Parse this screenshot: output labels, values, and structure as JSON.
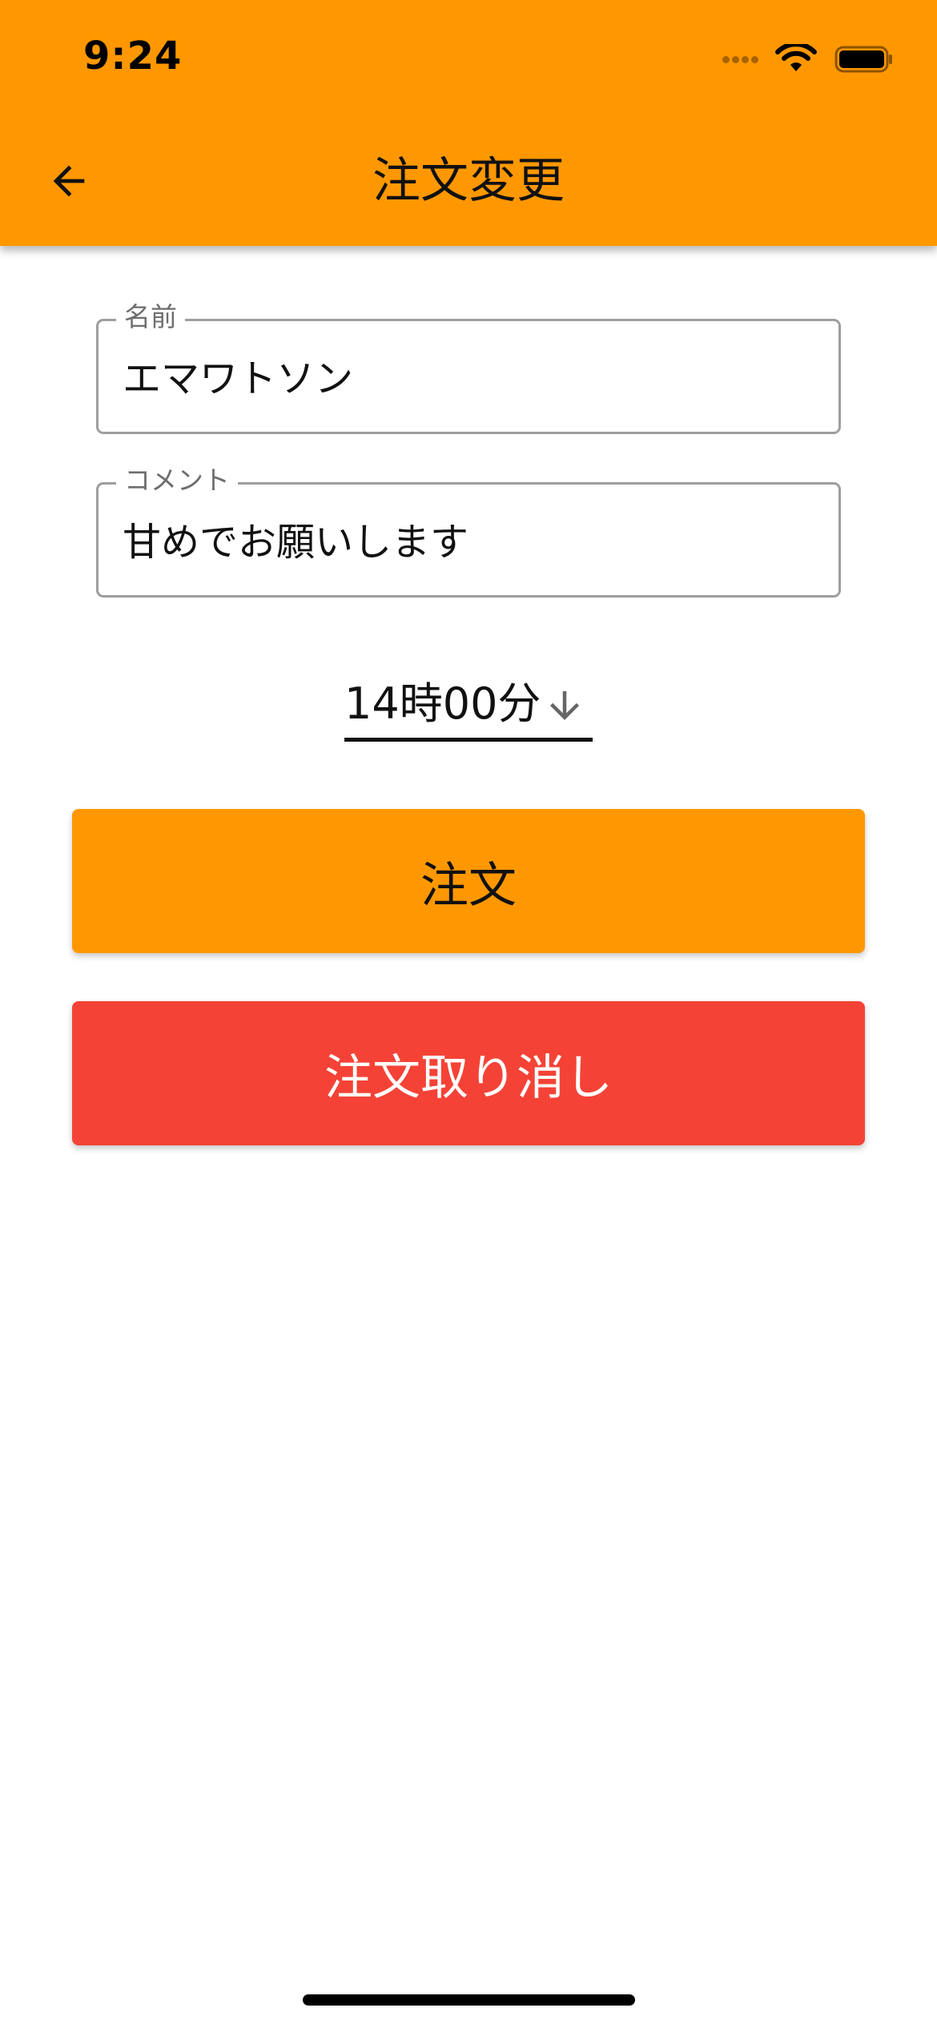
{
  "status_bar": {
    "time": "9:24",
    "icons": [
      "signal-dots-icon",
      "wifi-icon",
      "battery-icon"
    ]
  },
  "app_bar": {
    "title": "注文変更",
    "back_icon": "arrow-left-icon",
    "background": "#ff9800"
  },
  "form": {
    "name": {
      "label": "名前",
      "value": "エマワトソン"
    },
    "comment": {
      "label": "コメント",
      "value": "甘めでお願いします"
    },
    "time": {
      "selected": "14時00分",
      "icon": "arrow-down-icon"
    }
  },
  "buttons": {
    "order_label": "注文",
    "order_color": "#ff9800",
    "cancel_label": "注文取り消し",
    "cancel_color": "#f44336"
  }
}
